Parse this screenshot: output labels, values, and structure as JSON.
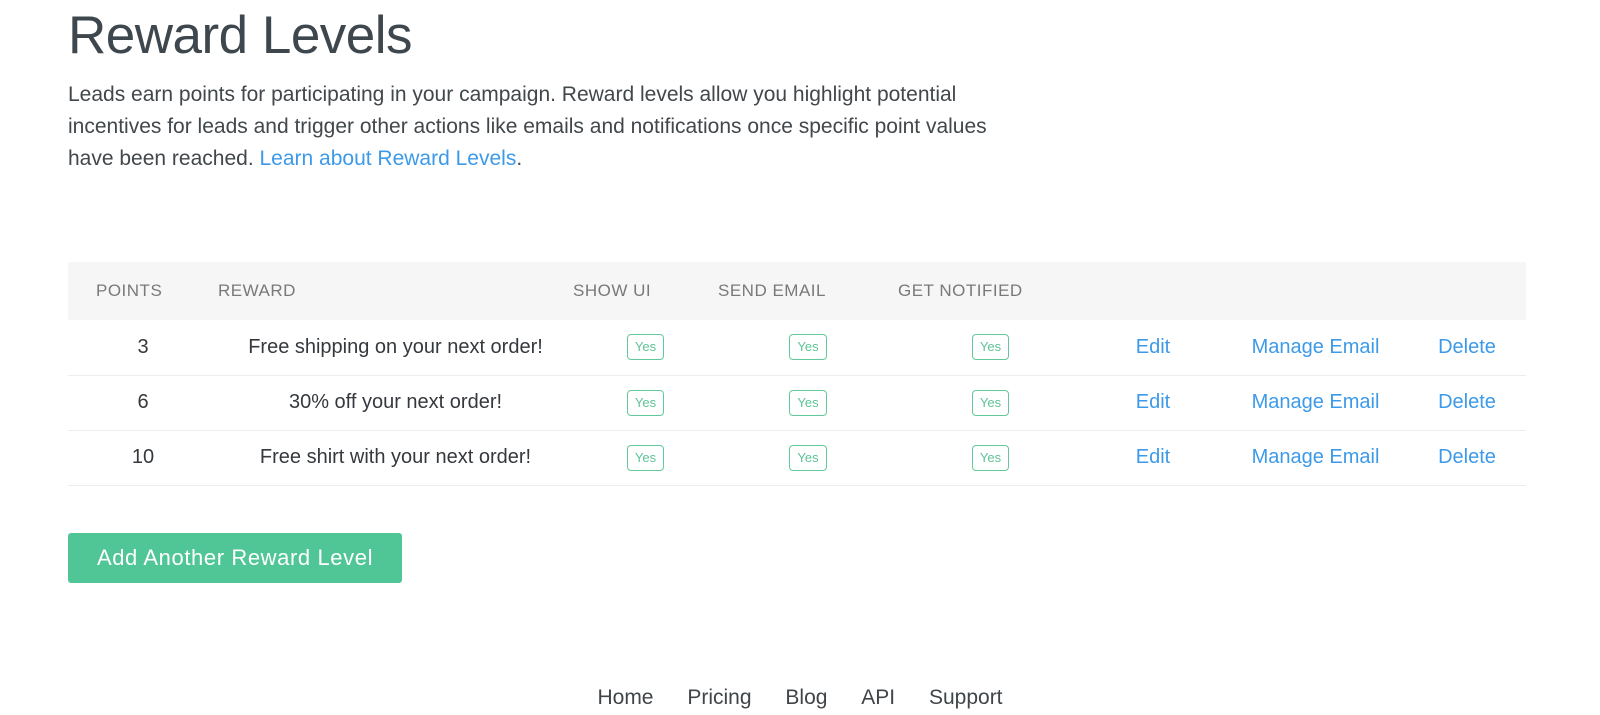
{
  "header": {
    "title": "Reward Levels",
    "description_part1": "Leads earn points for participating in your campaign. Reward levels allow you highlight potential incentives for leads and trigger other actions like emails and notifications once specific point values have been reached. ",
    "description_link": "Learn about Reward Levels",
    "description_part2": "."
  },
  "table": {
    "columns": [
      {
        "key": "points",
        "label": "POINTS"
      },
      {
        "key": "reward",
        "label": "REWARD"
      },
      {
        "key": "show_ui",
        "label": "SHOW UI"
      },
      {
        "key": "send_email",
        "label": "SEND EMAIL"
      },
      {
        "key": "get_notified",
        "label": "GET NOTIFIED"
      },
      {
        "key": "edit",
        "label": ""
      },
      {
        "key": "manage",
        "label": ""
      },
      {
        "key": "delete",
        "label": ""
      }
    ],
    "rows": [
      {
        "points": "3",
        "reward": "Free shipping on your next order!",
        "show_ui": "Yes",
        "send_email": "Yes",
        "get_notified": "Yes",
        "edit": "Edit",
        "manage": "Manage Email",
        "delete": "Delete"
      },
      {
        "points": "6",
        "reward": "30% off your next order!",
        "show_ui": "Yes",
        "send_email": "Yes",
        "get_notified": "Yes",
        "edit": "Edit",
        "manage": "Manage Email",
        "delete": "Delete"
      },
      {
        "points": "10",
        "reward": "Free shirt with your next order!",
        "show_ui": "Yes",
        "send_email": "Yes",
        "get_notified": "Yes",
        "edit": "Edit",
        "manage": "Manage Email",
        "delete": "Delete"
      }
    ]
  },
  "actions": {
    "add_reward_level": "Add Another Reward Level"
  },
  "footer": {
    "links": [
      "Home",
      "Pricing",
      "Blog",
      "API",
      "Support"
    ]
  },
  "colors": {
    "link": "#3d9ae8",
    "button_green": "#50c596",
    "badge_green": "#5fc398",
    "header_bg": "#f6f6f6",
    "heading_text": "#3e474d"
  }
}
